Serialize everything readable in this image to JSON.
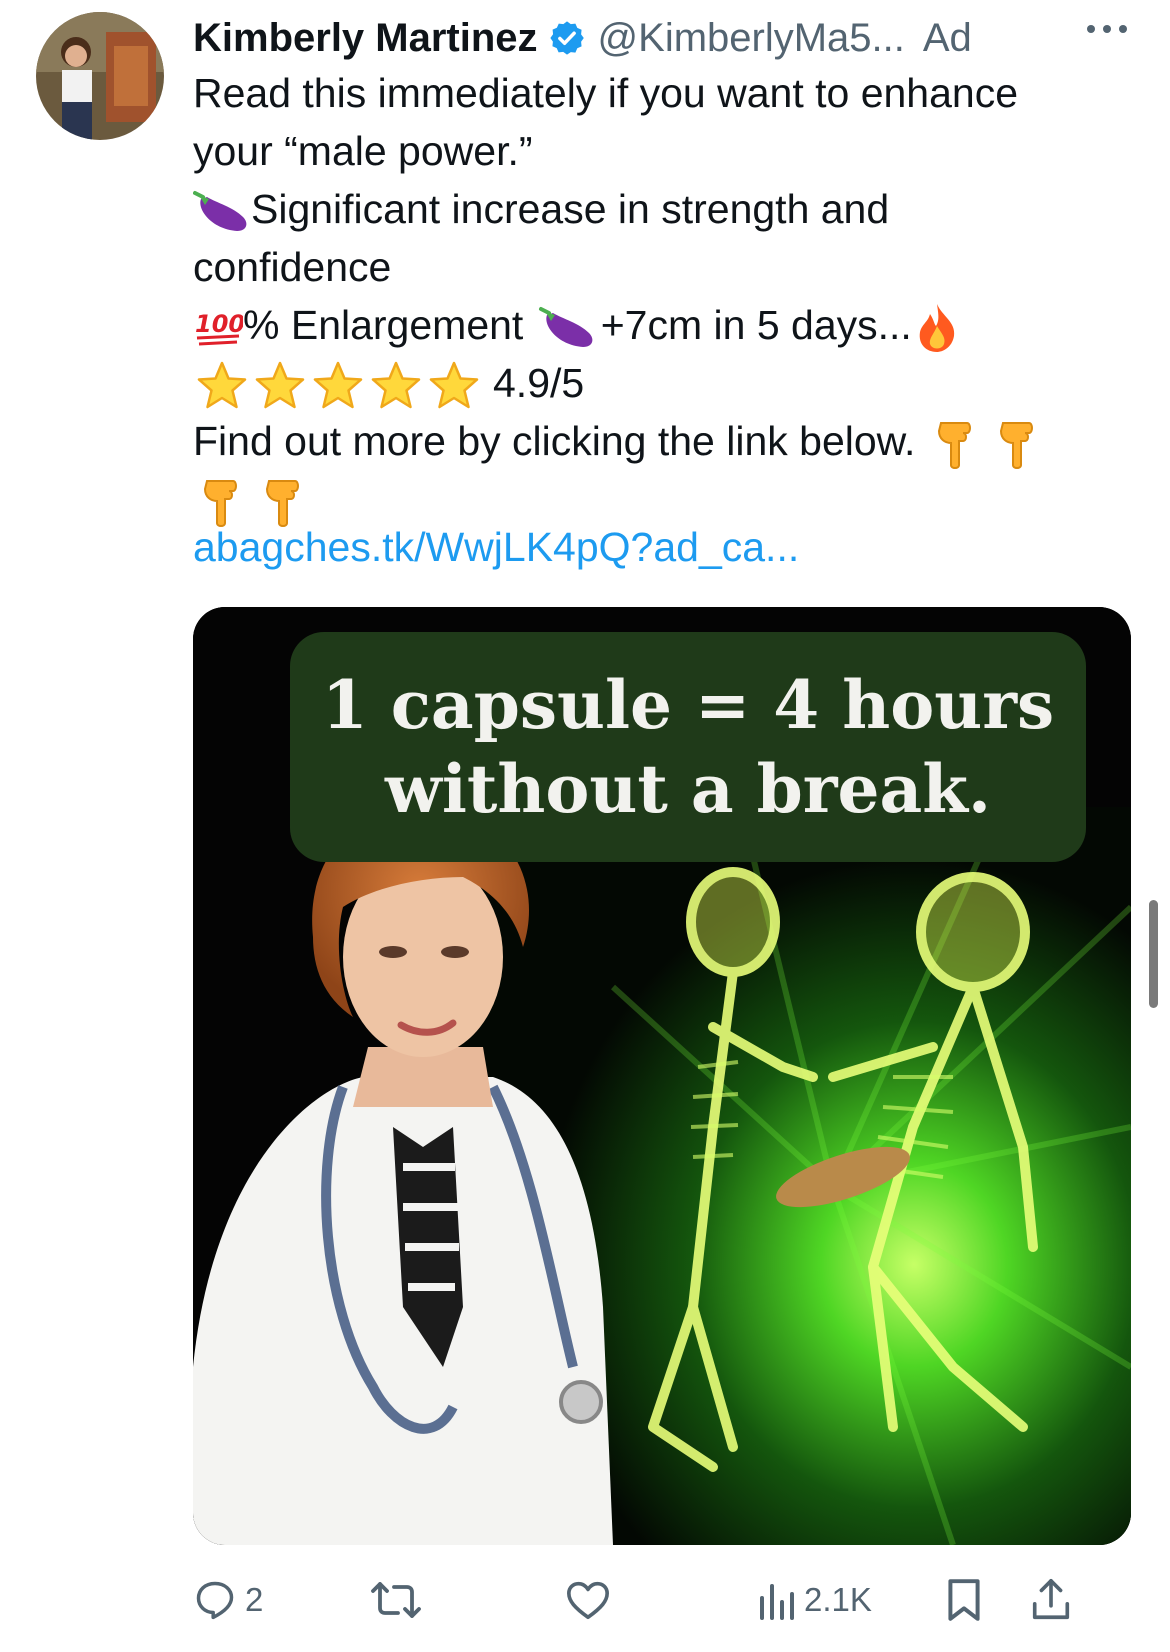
{
  "tweet": {
    "author": {
      "display_name": "Kimberly Martinez",
      "handle": "@KimberlyMa5...",
      "verified": true,
      "avatar_icon": "profile-photo"
    },
    "ad_label": "Ad",
    "more_icon": "more-horizontal-icon",
    "text": {
      "line1": "Read this immediately if you want to enhance",
      "line2": "your “male power.”",
      "line3": "Significant increase in strength and",
      "line4": "confidence",
      "line5_percent": "% Enlargement",
      "line5_gain": "+7cm in 5 days...",
      "rating": "4.9/5",
      "line7": "Find out more by clicking the link below."
    },
    "link": "abagches.tk/WwjLK4pQ?ad_ca...",
    "media": {
      "caption_line1": "1 capsule = 4 hours",
      "caption_line2": "without a break."
    },
    "actions": {
      "reply_count": "2",
      "retweet_count": "",
      "like_count": "",
      "views_count": "2.1K"
    }
  },
  "colors": {
    "link": "#1d9bf0",
    "secondary_text": "#536471",
    "verified": "#1d9bf0",
    "caption_box": "#1f3a19"
  }
}
